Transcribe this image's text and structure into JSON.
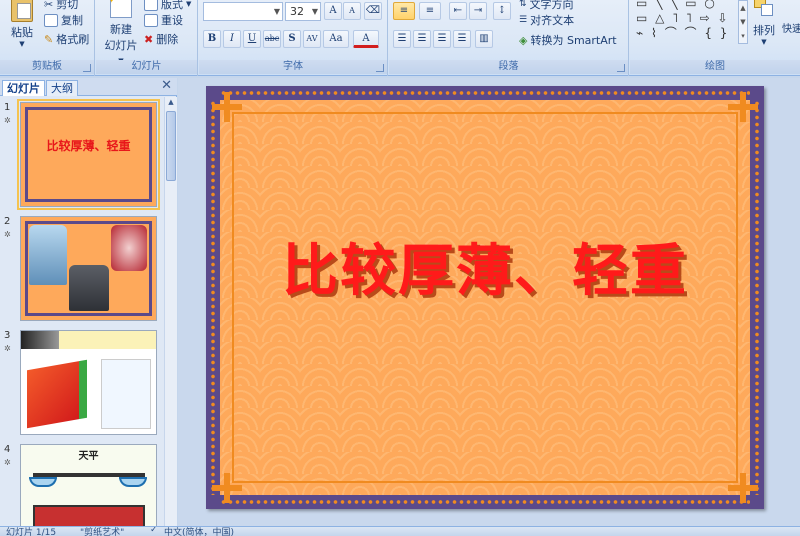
{
  "ribbon": {
    "clipboard": {
      "paste": "粘贴",
      "cut": "剪切",
      "copy": "复制",
      "format_painter": "格式刷",
      "group_label": "剪贴板"
    },
    "slides": {
      "new_slide_line1": "新建",
      "new_slide_line2": "幻灯片",
      "layout": "版式",
      "reset": "重设",
      "delete": "删除",
      "group_label": "幻灯片"
    },
    "font": {
      "font_size": "32",
      "group_label": "字体",
      "bold": "B",
      "italic": "I",
      "underline": "U",
      "strike": "abc",
      "shadow": "S",
      "spacing": "AV",
      "case": "Aa",
      "color": "A",
      "grow": "A",
      "shrink": "A"
    },
    "paragraph": {
      "text_direction": "文字方向",
      "align_text": "对齐文本",
      "smartart": "转换为 SmartArt",
      "group_label": "段落"
    },
    "drawing": {
      "arrange": "排列",
      "quick_styles": "快速",
      "group_label": "绘图"
    }
  },
  "left_pane": {
    "tabs": [
      "幻灯片",
      "大纲"
    ],
    "close": "✕",
    "slides": [
      {
        "number": "1",
        "title": "比较厚薄、轻重"
      },
      {
        "number": "2"
      },
      {
        "number": "3"
      },
      {
        "number": "4",
        "label": "天平"
      }
    ]
  },
  "main_slide": {
    "title": "比较厚薄、轻重"
  },
  "status_bar": {
    "slide_info": "幻灯片 1/15",
    "theme": "\"剪纸艺术\"",
    "language": "中文(简体，中国)"
  },
  "colors": {
    "slide_bg": "#fea95b",
    "frame": "#5b4a8a",
    "accent": "#f08b20",
    "title": "#ff1a1a"
  }
}
